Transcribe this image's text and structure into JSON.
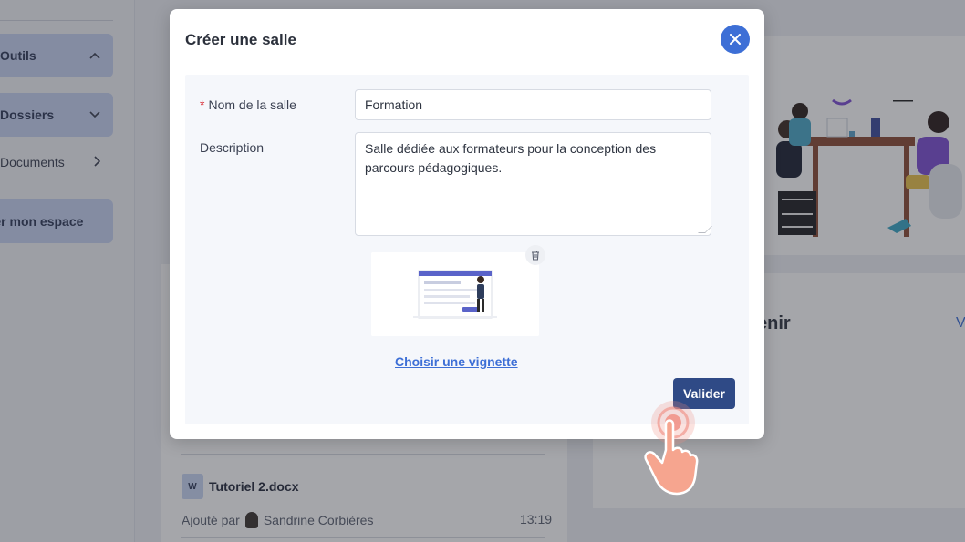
{
  "sidebar": {
    "items": [
      {
        "label": "Outils",
        "chevron": "chevron-up"
      },
      {
        "label": "Dossiers",
        "chevron": "chevron-down"
      },
      {
        "label": "Documents",
        "chevron": "chevron-right"
      }
    ],
    "cta_label": "Personnaliser mon espace"
  },
  "background": {
    "section_heading": "enir",
    "view_all_fragment": "V",
    "file": {
      "icon_letter": "W",
      "name": "Tutoriel 2.docx",
      "added_by_prefix": "Ajouté par",
      "author": "Sandrine Corbières",
      "time": "13:19"
    }
  },
  "modal": {
    "title": "Créer une salle",
    "close_icon": "close-icon",
    "form": {
      "name_required_mark": "*",
      "name_label": "Nom de la salle",
      "name_value": "Formation",
      "description_label": "Description",
      "description_value": "Salle dédiée aux formateurs pour la conception des parcours pédagogiques.",
      "delete_icon": "trash-icon",
      "choose_thumbnail_label": "Choisir une vignette",
      "submit_label": "Valider"
    }
  },
  "colors": {
    "accent": "#3d6fd6",
    "submit": "#2f4a86",
    "sidebar_active": "#c7d3f2",
    "required": "#d9363e",
    "tap": "#f08b7e"
  }
}
